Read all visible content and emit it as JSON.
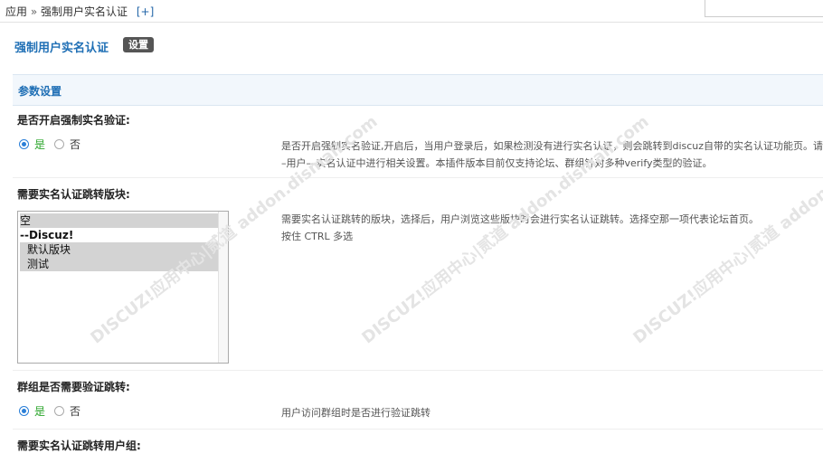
{
  "breadcrumb": {
    "app": "应用",
    "sep": "»",
    "page": "强制用户实名认证",
    "add": "[+]"
  },
  "header": {
    "title": "强制用户实名认证",
    "settings_button": "设置"
  },
  "section": {
    "title": "参数设置"
  },
  "setting1": {
    "label": "是否开启强制实名验证:",
    "yes": "是",
    "no": "否",
    "selected": "是",
    "desc_line1": "是否开启强制实名验证,开启后，当用户登录后，如果检测没有进行实名认证，则会跳转到discuz自带的实名认证功能页。请",
    "desc_line2": "–用户––实名认证中进行相关设置。本插件版本目前仅支持论坛、群组针对多种verify类型的验证。"
  },
  "setting2": {
    "label": "需要实名认证跳转版块:",
    "options": [
      {
        "text": "空",
        "selected": true,
        "group": false
      },
      {
        "text": "--Discuz!",
        "selected": false,
        "group": true
      },
      {
        "text": "  默认版块",
        "selected": true,
        "group": false
      },
      {
        "text": "  测试",
        "selected": true,
        "group": false
      }
    ],
    "desc_line1": "需要实名认证跳转的版块，选择后，用户浏览这些版块时会进行实名认证跳转。选择空那一项代表论坛首页。",
    "desc_line2": "按住 CTRL 多选"
  },
  "setting3": {
    "label": "群组是否需要验证跳转:",
    "yes": "是",
    "no": "否",
    "selected": "是",
    "desc_line1": "用户访问群组时是否进行验证跳转"
  },
  "setting4": {
    "label": "需要实名认证跳转用户组:"
  },
  "watermark": {
    "text": "DISCUZ!应用中心|贰道 addon.dismall.com"
  },
  "colors": {
    "accent": "#1f6fb5",
    "yes": "#2aa52a",
    "section_bg": "#f2f7fc"
  }
}
